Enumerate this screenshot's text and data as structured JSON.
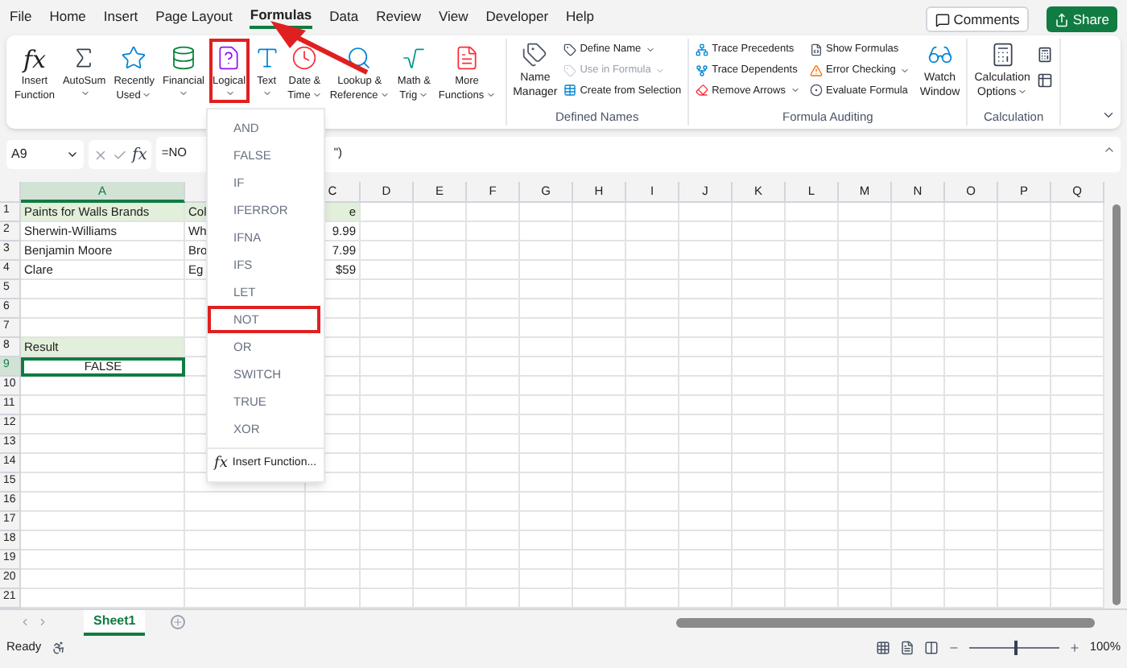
{
  "menu_tabs": [
    {
      "label": "File",
      "selected": false
    },
    {
      "label": "Home",
      "selected": false
    },
    {
      "label": "Insert",
      "selected": false
    },
    {
      "label": "Page Layout",
      "selected": false
    },
    {
      "label": "Formulas",
      "selected": true
    },
    {
      "label": "Data",
      "selected": false
    },
    {
      "label": "Review",
      "selected": false
    },
    {
      "label": "View",
      "selected": false
    },
    {
      "label": "Developer",
      "selected": false
    },
    {
      "label": "Help",
      "selected": false
    }
  ],
  "header_buttons": [
    {
      "label": "Comments",
      "kind": "outline"
    },
    {
      "label": "Share",
      "kind": "primary"
    }
  ],
  "function_library": [
    {
      "lines": [
        "Insert",
        "Function"
      ],
      "glyph": "fx",
      "dropdown": false,
      "highlighted": false
    },
    {
      "lines": [
        "AutoSum"
      ],
      "dropdown": true,
      "highlighted": false
    },
    {
      "lines": [
        "Recently",
        "Used"
      ],
      "dropdown": true,
      "highlighted": false
    },
    {
      "lines": [
        "Financial"
      ],
      "dropdown": true,
      "highlighted": false
    },
    {
      "lines": [
        "Logical"
      ],
      "dropdown": true,
      "highlighted": true
    },
    {
      "lines": [
        "Text"
      ],
      "dropdown": true,
      "highlighted": false
    },
    {
      "lines": [
        "Date &",
        "Time"
      ],
      "dropdown": true,
      "highlighted": false
    },
    {
      "lines": [
        "Lookup &",
        "Reference"
      ],
      "dropdown": true,
      "highlighted": false
    },
    {
      "lines": [
        "Math &",
        "Trig"
      ],
      "dropdown": true,
      "highlighted": false
    },
    {
      "lines": [
        "More",
        "Functions"
      ],
      "dropdown": true,
      "highlighted": false
    }
  ],
  "defined_names": {
    "manager": [
      "Name",
      "Manager"
    ],
    "items": [
      {
        "label": "Define Name",
        "dropdown": true,
        "disabled": false
      },
      {
        "label": "Use in Formula",
        "dropdown": true,
        "disabled": true
      },
      {
        "label": "Create from Selection",
        "dropdown": false,
        "disabled": false
      }
    ],
    "title": "Defined Names"
  },
  "formula_auditing": {
    "columns": [
      [
        {
          "label": "Trace Precedents",
          "dropdown": false
        },
        {
          "label": "Trace Dependents",
          "dropdown": false
        },
        {
          "label": "Remove Arrows",
          "dropdown": true
        }
      ],
      [
        {
          "label": "Show Formulas",
          "dropdown": false
        },
        {
          "label": "Error Checking",
          "dropdown": true
        },
        {
          "label": "Evaluate Formula",
          "dropdown": false
        }
      ]
    ],
    "watch": [
      "Watch",
      "Window"
    ],
    "title": "Formula Auditing"
  },
  "calculation": {
    "options": [
      "Calculation",
      "Options"
    ],
    "title": "Calculation"
  },
  "formula_bar": {
    "name_box": "A9",
    "glyph": "fx",
    "formula_parts": [
      "=NO",
      "\")"
    ]
  },
  "columns": [
    {
      "label": "A",
      "selected": true
    },
    {
      "selected": false
    },
    {
      "label": "C",
      "selected": false
    },
    {
      "label": "D",
      "selected": false
    },
    {
      "label": "E",
      "selected": false
    },
    {
      "label": "F",
      "selected": false
    },
    {
      "label": "G",
      "selected": false
    },
    {
      "label": "H",
      "selected": false
    },
    {
      "label": "I",
      "selected": false
    },
    {
      "label": "J",
      "selected": false
    },
    {
      "label": "K",
      "selected": false
    },
    {
      "label": "L",
      "selected": false
    },
    {
      "label": "M",
      "selected": false
    },
    {
      "label": "N",
      "selected": false
    },
    {
      "label": "O",
      "selected": false
    },
    {
      "label": "P",
      "selected": false
    },
    {
      "label": "Q",
      "selected": false
    }
  ],
  "rows": [
    {
      "label": "1",
      "selected": false,
      "cells": [
        {
          "text": "Paints for Walls Brands",
          "kind": "text",
          "shaded": true,
          "selected": false
        },
        {
          "text": "Col",
          "kind": "text",
          "shaded": true,
          "selected": false
        },
        {
          "text": "e",
          "kind": "text",
          "shaded": true,
          "selected": false
        }
      ]
    },
    {
      "label": "2",
      "selected": false,
      "cells": [
        {
          "text": "Sherwin-Williams",
          "kind": "text",
          "shaded": false,
          "selected": false
        },
        {
          "text": "Wh",
          "kind": "text",
          "shaded": false,
          "selected": false
        },
        {
          "text": "9.99",
          "kind": "text",
          "shaded": false,
          "selected": false
        }
      ]
    },
    {
      "label": "3",
      "selected": false,
      "cells": [
        {
          "text": "Benjamin Moore",
          "kind": "text",
          "shaded": false,
          "selected": false
        },
        {
          "text": "Bro",
          "kind": "text",
          "shaded": false,
          "selected": false
        },
        {
          "text": "7.99",
          "kind": "text",
          "shaded": false,
          "selected": false
        }
      ]
    },
    {
      "label": "4",
      "selected": false,
      "cells": [
        {
          "text": "Clare",
          "kind": "text",
          "shaded": false,
          "selected": false
        },
        {
          "text": "Eg",
          "kind": "text",
          "shaded": false,
          "selected": false
        },
        {
          "text": "$59",
          "kind": "text",
          "shaded": false,
          "selected": false
        }
      ]
    },
    {
      "label": "5",
      "selected": false
    },
    {
      "label": "6",
      "selected": false
    },
    {
      "label": "7",
      "selected": false
    },
    {
      "label": "8",
      "selected": false,
      "cells": [
        {
          "text": "Result",
          "kind": "text",
          "shaded": true,
          "selected": false
        }
      ]
    },
    {
      "label": "9",
      "selected": true,
      "cells": [
        {
          "text": "FALSE",
          "kind": "boolean",
          "shaded": false,
          "selected": true
        }
      ]
    },
    {
      "label": "10",
      "selected": false
    },
    {
      "label": "11",
      "selected": false
    },
    {
      "label": "12",
      "selected": false
    },
    {
      "label": "13",
      "selected": false
    },
    {
      "label": "14",
      "selected": false
    },
    {
      "label": "15",
      "selected": false
    },
    {
      "label": "16",
      "selected": false
    },
    {
      "label": "17",
      "selected": false
    },
    {
      "label": "18",
      "selected": false
    },
    {
      "label": "19",
      "selected": false
    },
    {
      "label": "20",
      "selected": false
    },
    {
      "label": "21",
      "selected": false
    }
  ],
  "logical_menu": {
    "items": [
      {
        "label": "AND",
        "highlighted": false
      },
      {
        "label": "FALSE",
        "highlighted": false
      },
      {
        "label": "IF",
        "highlighted": false
      },
      {
        "label": "IFERROR",
        "highlighted": false
      },
      {
        "label": "IFNA",
        "highlighted": false
      },
      {
        "label": "IFS",
        "highlighted": false
      },
      {
        "label": "LET",
        "highlighted": false
      },
      {
        "label": "NOT",
        "highlighted": true
      },
      {
        "label": "OR",
        "highlighted": false
      },
      {
        "label": "SWITCH",
        "highlighted": false
      },
      {
        "label": "TRUE",
        "highlighted": false
      },
      {
        "label": "XOR",
        "highlighted": false
      }
    ],
    "footer": {
      "glyph": "fx",
      "label": "Insert Function..."
    }
  },
  "sheet_tabs": [
    {
      "label": "Sheet1",
      "selected": true
    }
  ],
  "status_bar": {
    "text": "Ready",
    "zoom": {
      "level": 0.5,
      "label": "100%"
    }
  }
}
